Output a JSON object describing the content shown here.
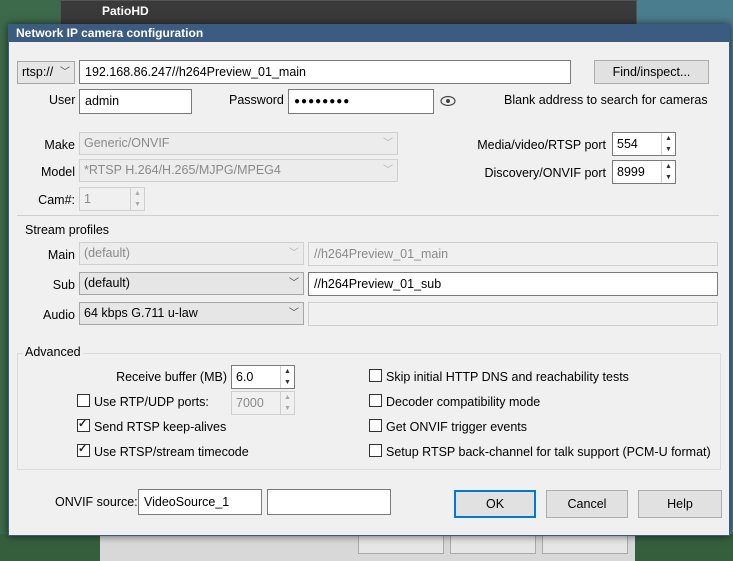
{
  "background": {
    "window_title": "PatioHD"
  },
  "dialog": {
    "title": "Network IP camera configuration"
  },
  "connection": {
    "protocol": "rtsp://",
    "address": "192.168.86.247//h264Preview_01_main",
    "find_button": "Find/inspect...",
    "user_label": "User",
    "user_value": "admin",
    "password_label": "Password",
    "password_value": "●●●●●●●●",
    "hint": "Blank address to search for cameras"
  },
  "device": {
    "make_label": "Make",
    "make_value": "Generic/ONVIF",
    "model_label": "Model",
    "model_value": "*RTSP H.264/H.265/MJPG/MPEG4",
    "cam_label": "Cam#:",
    "cam_value": "1",
    "media_port_label": "Media/video/RTSP port",
    "media_port_value": "554",
    "discovery_port_label": "Discovery/ONVIF port",
    "discovery_port_value": "8999"
  },
  "streams": {
    "section_label": "Stream profiles",
    "main_label": "Main",
    "main_profile": "(default)",
    "main_path": "//h264Preview_01_main",
    "sub_label": "Sub",
    "sub_profile": "(default)",
    "sub_path": "//h264Preview_01_sub",
    "audio_label": "Audio",
    "audio_profile": "64 kbps G.711 u-law",
    "audio_path": ""
  },
  "advanced": {
    "section_label": "Advanced",
    "receive_buffer_label": "Receive buffer (MB)",
    "receive_buffer_value": "6.0",
    "use_rtp_udp_label": "Use RTP/UDP ports:",
    "use_rtp_udp_checked": false,
    "rtp_port_value": "7000",
    "keepalives_label": "Send RTSP keep-alives",
    "keepalives_checked": true,
    "timecode_label": "Use RTSP/stream timecode",
    "timecode_checked": true,
    "skip_dns_label": "Skip initial HTTP DNS and reachability tests",
    "skip_dns_checked": false,
    "decoder_compat_label": "Decoder compatibility mode",
    "decoder_compat_checked": false,
    "onvif_events_label": "Get ONVIF trigger events",
    "onvif_events_checked": false,
    "backchannel_label": "Setup RTSP back-channel for talk support (PCM-U format)",
    "backchannel_checked": false
  },
  "footer": {
    "onvif_source_label": "ONVIF source:",
    "onvif_source_value": "VideoSource_1",
    "onvif_source_extra": "",
    "ok_button": "OK",
    "cancel_button": "Cancel",
    "help_button": "Help"
  },
  "colors": {
    "titlebar": "#3b5b80",
    "accent": "#0078d7"
  }
}
